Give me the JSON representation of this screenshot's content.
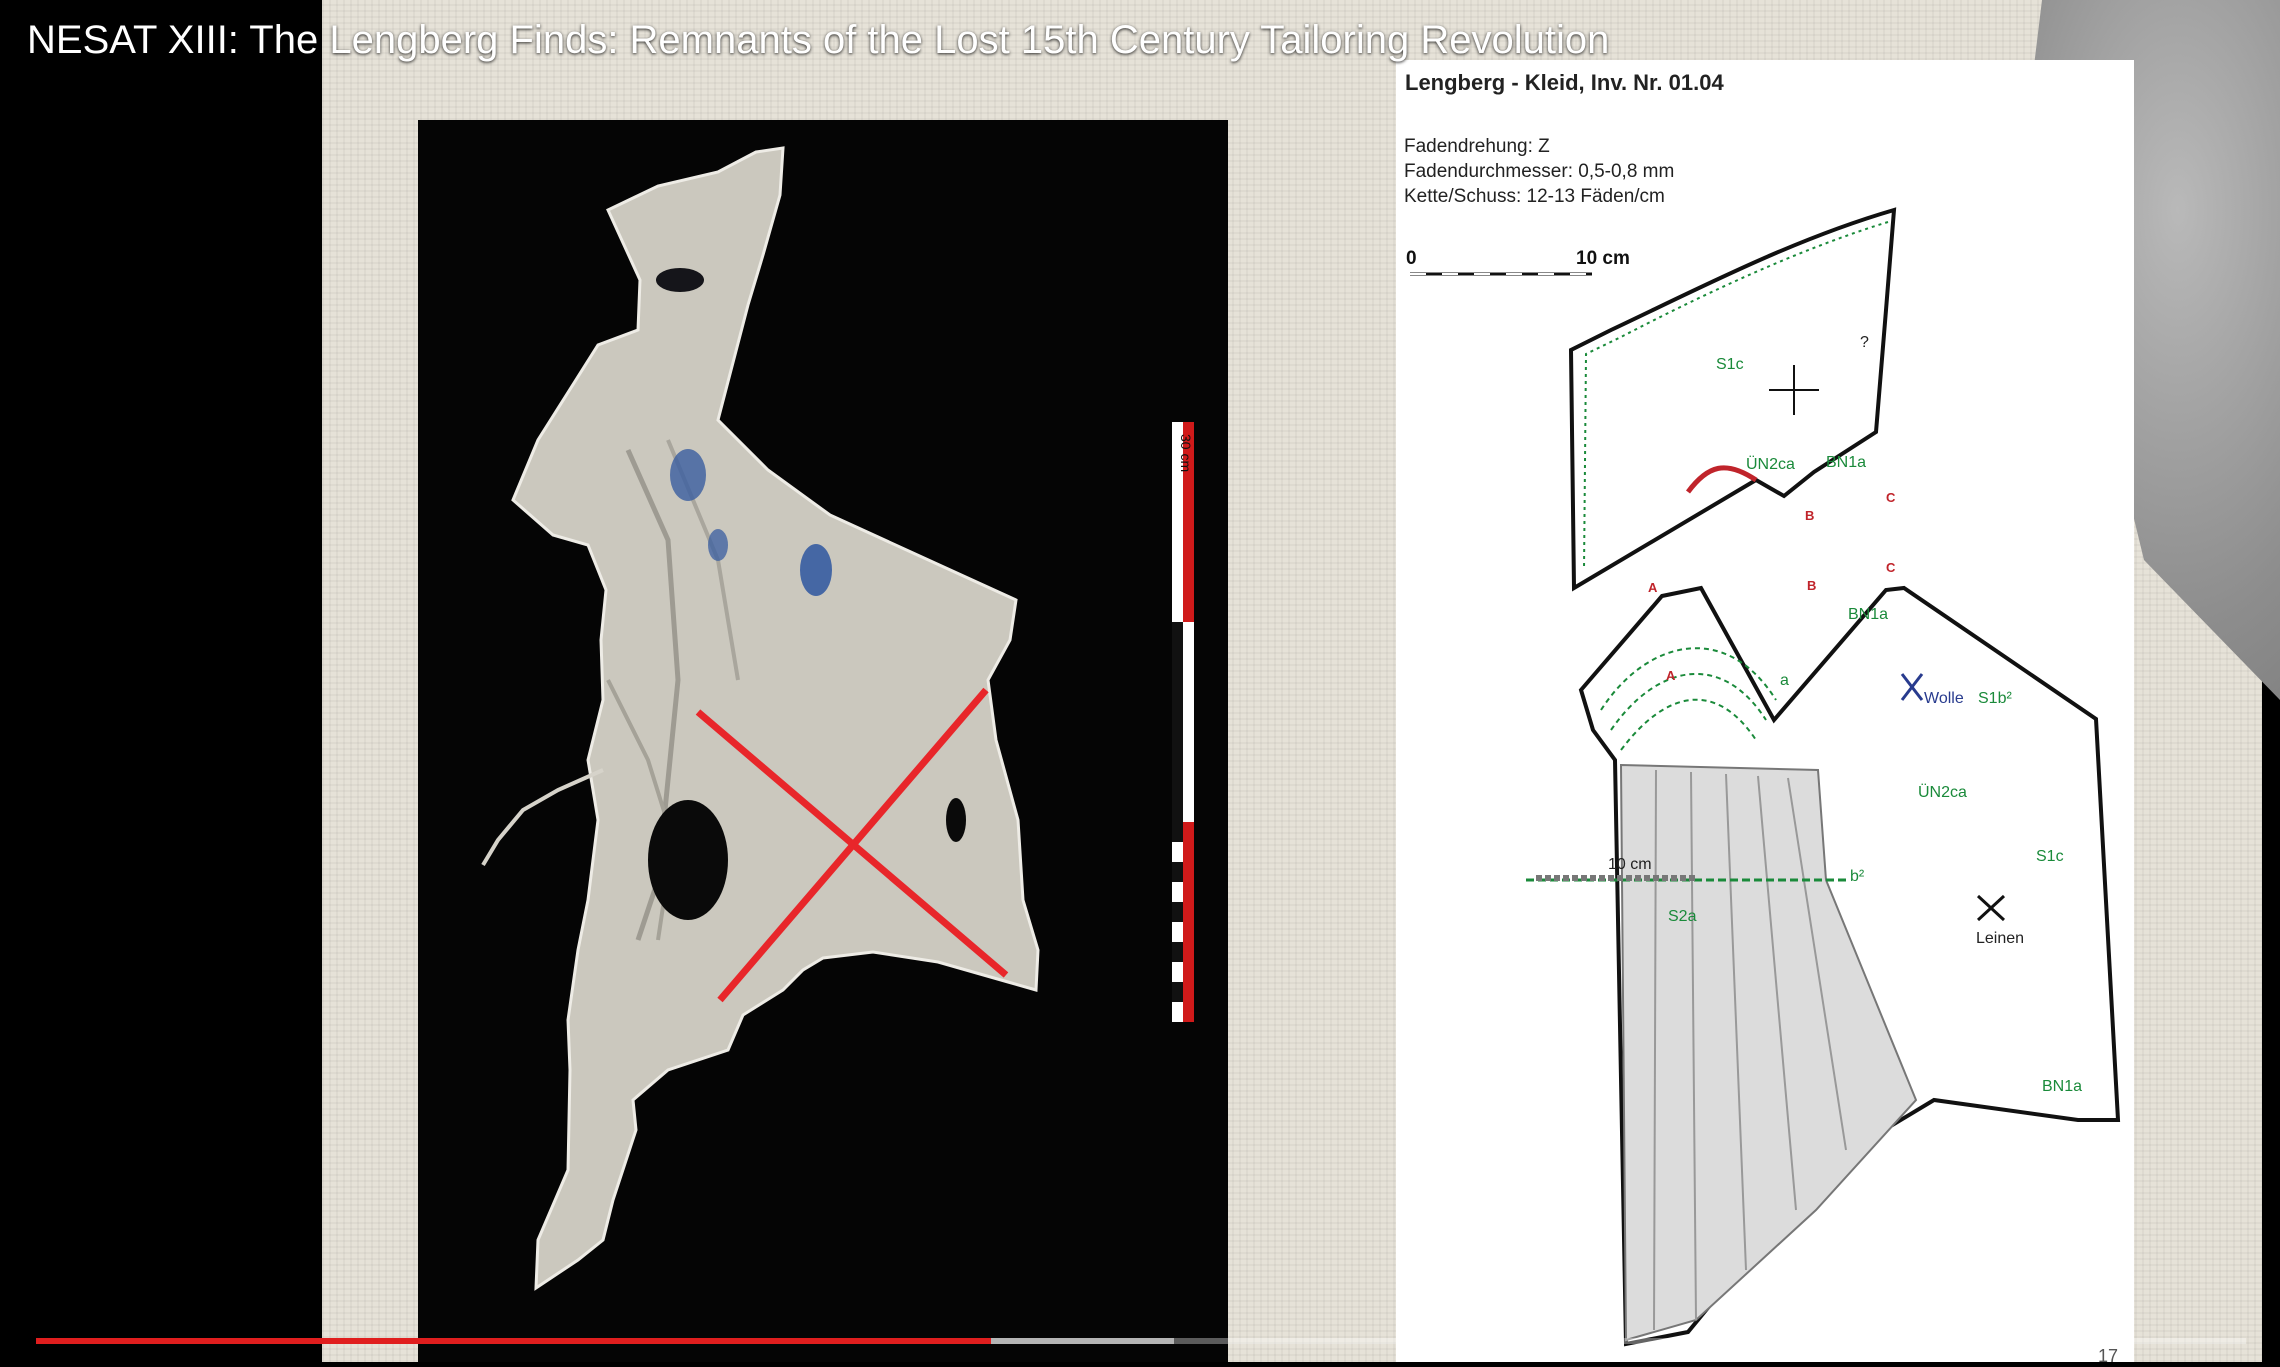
{
  "video": {
    "title": "NESAT XIII: The Lengberg Finds: Remnants of the Lost 15th Century Tailoring Revolution",
    "progress": {
      "played": 0.432,
      "buffered": 0.515,
      "color": "#e01e1e"
    }
  },
  "slide": {
    "number": "17",
    "photo": {
      "ruler_label": "30 cm"
    },
    "pattern": {
      "title": "Lengberg - Kleid, Inv. Nr. 01.04",
      "specs": [
        "Fadendrehung: Z",
        "Fadendurchmesser: 0,5-0,8 mm",
        "Kette/Schuss: 12-13 Fäden/cm"
      ],
      "scale_start": "0",
      "scale_end": "10 cm",
      "labels": {
        "s1c_top": "S1c",
        "question": "?",
        "un2ca_top": "ÜN2ca",
        "bn1a_top": "BN1a",
        "point_a1": "A",
        "point_b1": "B",
        "point_c1": "C",
        "point_a2": "A",
        "point_b2": "B",
        "point_c2": "C",
        "bn1a_mid": "BN1a",
        "a_small": "a",
        "wolle": "Wolle",
        "s1b": "S1b²",
        "un2ca_mid": "ÜN2ca",
        "ten_cm": "10 cm",
        "b2": "b²",
        "s2a": "S2a",
        "s1c_right": "S1c",
        "leinen": "Leinen",
        "bn1a_bottom": "BN1a"
      }
    }
  },
  "colors": {
    "seam_green": "#1a8a3a",
    "point_red": "#c0242b",
    "cross_red": "#e8262a",
    "wolle_blue": "#283b8e"
  }
}
